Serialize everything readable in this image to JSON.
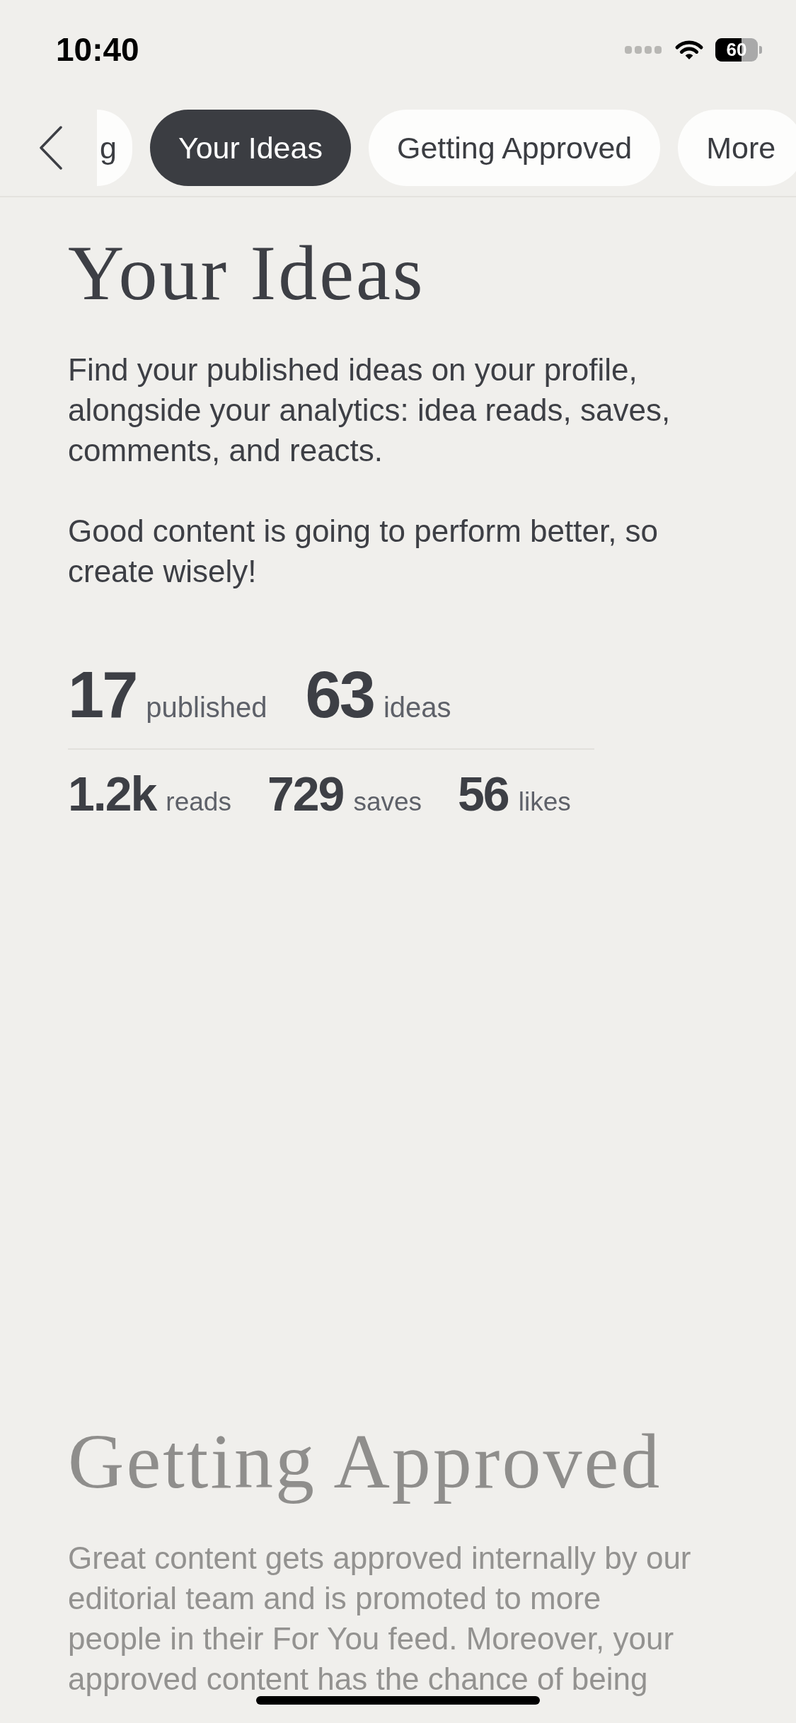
{
  "status_bar": {
    "time": "10:40",
    "battery": "60"
  },
  "tabs": [
    {
      "label": "g",
      "selected": false
    },
    {
      "label": "Your Ideas",
      "selected": true
    },
    {
      "label": "Getting Approved",
      "selected": false
    },
    {
      "label": "More",
      "selected": false
    }
  ],
  "sections": [
    {
      "title": "Your Ideas",
      "active": true,
      "paragraphs": [
        "Find your published ideas on your profile, alongside your analytics: idea reads, saves, comments, and reacts.",
        "Good content is going to perform better, so create wisely!"
      ],
      "stats": {
        "primary": [
          {
            "value": "17",
            "unit": "published"
          },
          {
            "value": "63",
            "unit": "ideas"
          }
        ],
        "secondary": [
          {
            "value": "1.2k",
            "unit": "reads"
          },
          {
            "value": "729",
            "unit": "saves"
          },
          {
            "value": "56",
            "unit": "likes"
          }
        ]
      }
    },
    {
      "title": "Getting Approved",
      "active": false,
      "paragraphs": [
        "Great content gets approved internally by our editorial team and is promoted to more people in their For You feed. Moreover, your approved content has the chance of being"
      ]
    }
  ]
}
